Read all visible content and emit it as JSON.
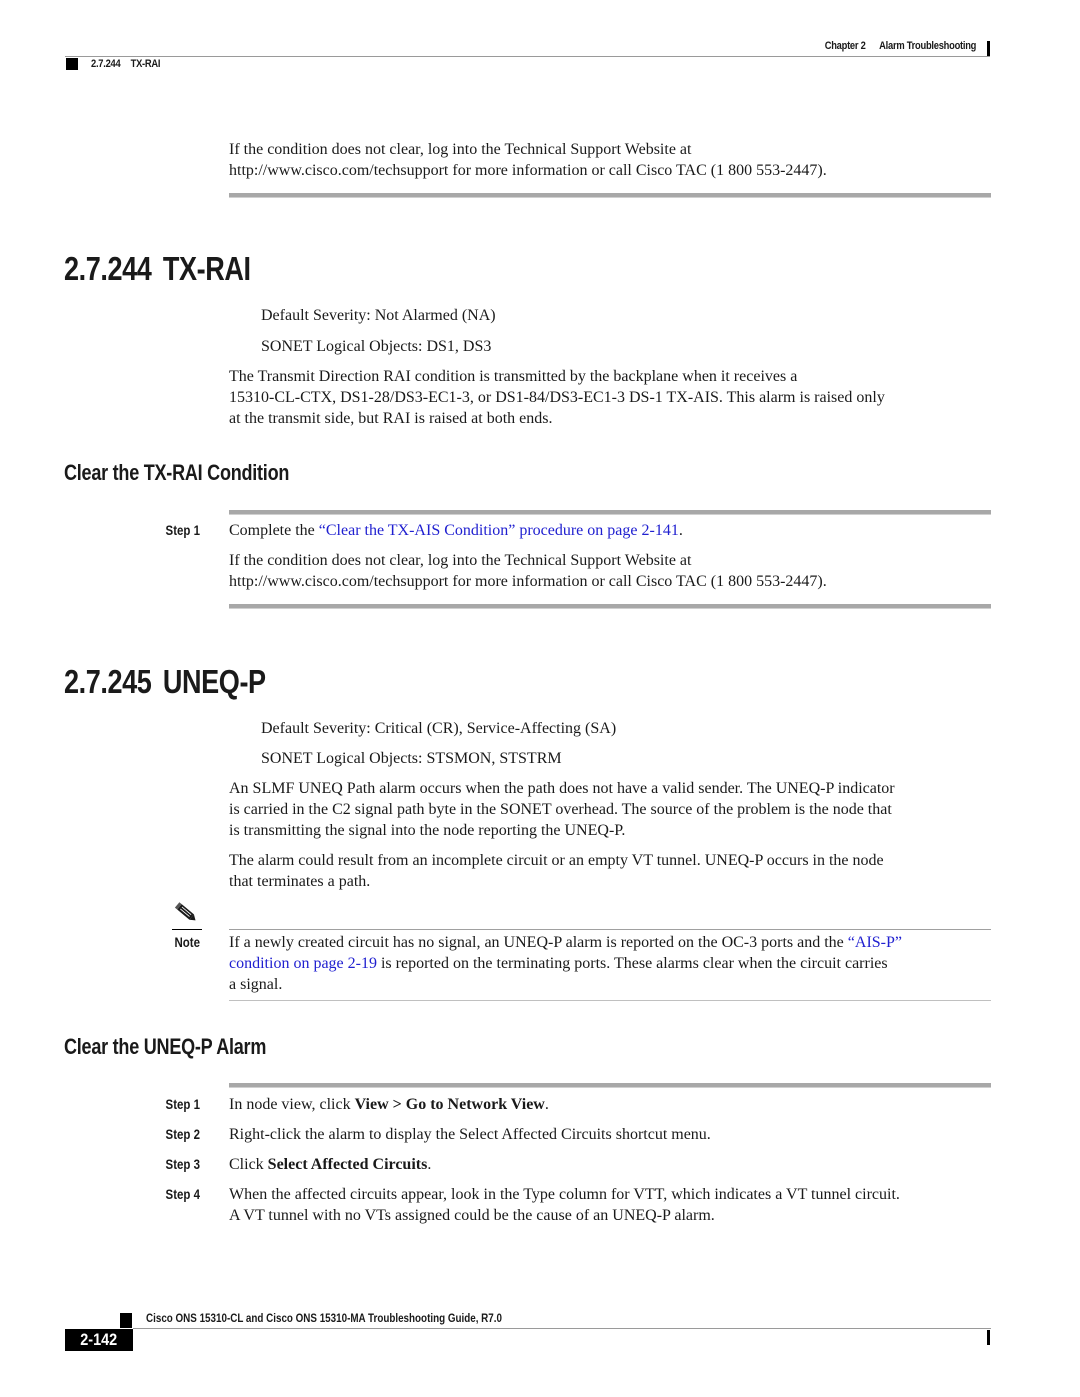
{
  "header": {
    "chapter_label": "Chapter 2",
    "chapter_title": "Alarm Troubleshooting",
    "section_number": "2.7.244",
    "section_title": "TX-RAI"
  },
  "intro": {
    "line1": "If the condition does not clear, log into the Technical Support Website at",
    "line2": "http://www.cisco.com/techsupport for more information or call Cisco TAC (1 800 553-2447)."
  },
  "section_244": {
    "number": "2.7.244",
    "title": "TX-RAI",
    "severity": "Default Severity: Not Alarmed (NA)",
    "objects": "SONET Logical Objects: DS1, DS3",
    "description": [
      "The Transmit Direction RAI condition is transmitted by the backplane when it receives a",
      "15310-CL-CTX, DS1-28/DS3-EC1-3, or DS1-84/DS3-EC1-3 DS-1 TX-AIS. This alarm is raised only",
      "at the transmit side, but RAI is raised at both ends."
    ],
    "procedure": {
      "title": "Clear the TX-RAI Condition",
      "steps": [
        {
          "label": "Step 1",
          "prefix": "Complete the ",
          "link": "“Clear the TX-AIS Condition” procedure on page 2-141",
          "suffix": "."
        }
      ],
      "followup": [
        "If the condition does not clear, log into the Technical Support Website at",
        "http://www.cisco.com/techsupport for more information or call Cisco TAC (1 800 553-2447)."
      ]
    }
  },
  "section_245": {
    "number": "2.7.245",
    "title": "UNEQ-P",
    "severity": "Default Severity: Critical (CR), Service-Affecting (SA)",
    "objects": "SONET Logical Objects: STSMON, STSTRM",
    "paragraph1": [
      "An SLMF UNEQ Path alarm occurs when the path does not have a valid sender. The UNEQ-P indicator",
      "is carried in the C2 signal path byte in the SONET overhead. The source of the problem is the node that",
      "is transmitting the signal into the node reporting the UNEQ-P."
    ],
    "paragraph2": [
      "The alarm could result from an incomplete circuit or an empty VT tunnel. UNEQ-P occurs in the node",
      "that terminates a path."
    ],
    "note": {
      "label": "Note",
      "icon": "pencil-icon",
      "line1_prefix": "If a newly created circuit has no signal, an UNEQ-P alarm is reported on the OC-3 ports and the ",
      "line1_link": "“AIS-P”",
      "line2_link": "condition on page 2-19",
      "line2_suffix": " is reported on the terminating ports. These alarms clear when the circuit carries",
      "line3": "a signal."
    },
    "procedure": {
      "title": "Clear the UNEQ-P Alarm",
      "steps": [
        {
          "label": "Step 1",
          "prefix": "In node view, click ",
          "bold": "View > Go to Network View",
          "suffix": "."
        },
        {
          "label": "Step 2",
          "text": "Right-click the alarm to display the Select Affected Circuits shortcut menu."
        },
        {
          "label": "Step 3",
          "prefix": "Click ",
          "bold": "Select Affected Circuits",
          "suffix": "."
        },
        {
          "label": "Step 4",
          "line1": "When the affected circuits appear, look in the Type column for VTT, which indicates a VT tunnel circuit.",
          "line2": "A VT tunnel with no VTs assigned could be the cause of an UNEQ-P alarm."
        }
      ]
    }
  },
  "footer": {
    "title": "Cisco ONS 15310-CL and Cisco ONS 15310-MA Troubleshooting Guide, R7.0",
    "page_number": "2-142"
  },
  "colors": {
    "link": "#2020d0",
    "rule": "#a8a8a8",
    "text": "#1a1a1a"
  }
}
